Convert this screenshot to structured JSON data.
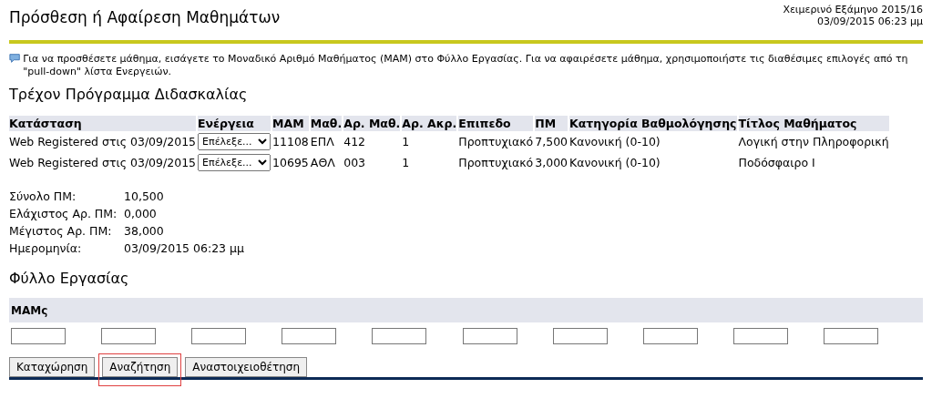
{
  "header": {
    "title": "Πρόσθεση ή Αφαίρεση Μαθημάτων",
    "term": "Χειμερινό Εξάμηνο 2015/16",
    "datetime": "03/09/2015 06:23 μμ"
  },
  "info": "Για να προσθέσετε μάθημα, εισάγετε το Μοναδικό Αριθμό Μαθήματος (ΜΑΜ) στο Φύλλο Εργασίας. Για να αφαιρέσετε μάθημα, χρησιμοποιήστε τις διαθέσιμες επιλογές από τη \"pull-down\" λίστα Ενεργειών.",
  "schedule": {
    "title": "Τρέχον Πρόγραμμα Διδασκαλίας",
    "columns": [
      "Κατάσταση",
      "Ενέργεια",
      "ΜΑΜ",
      "Μαθ.",
      "Αρ. Μαθ.",
      "Αρ. Ακρ.",
      "Επιπεδο",
      "ΠΜ",
      "Κατηγορία Βαθμολόγησης",
      "Τίτλος Μαθήματος"
    ],
    "rows": [
      {
        "status": "Web Registered στις 03/09/2015",
        "action": "Επέλεξε...",
        "mam": "11108",
        "subject": "ΕΠΛ",
        "course_no": "412",
        "credits_no": "1",
        "level": "Προπτυχιακό",
        "pm": "7,500",
        "grading": "Κανονική (0-10)",
        "title": "Λογική στην Πληροφορική"
      },
      {
        "status": "Web Registered στις 03/09/2015",
        "action": "Επέλεξε...",
        "mam": "10695",
        "subject": "ΑΘΛ",
        "course_no": "003",
        "credits_no": "1",
        "level": "Προπτυχιακό",
        "pm": "3,000",
        "grading": "Κανονική (0-10)",
        "title": "Ποδόσφαιρο Ι"
      }
    ]
  },
  "summary": [
    {
      "label": "Σύνολο ΠΜ:",
      "value": "10,500"
    },
    {
      "label": "Ελάχιστος Αρ. ΠΜ:",
      "value": "0,000"
    },
    {
      "label": "Μέγιστος Αρ. ΠΜ:",
      "value": "38,000"
    },
    {
      "label": "Ημερομηνία:",
      "value": "03/09/2015 06:23 μμ"
    }
  ],
  "worksheet": {
    "title": "Φύλλο Εργασίας",
    "column": "ΜΑΜς"
  },
  "buttons": [
    {
      "label": "Καταχώρηση",
      "highlighted": false
    },
    {
      "label": "Αναζήτηση",
      "highlighted": true
    },
    {
      "label": "Αναστοιχειοθέτηση",
      "highlighted": false
    }
  ]
}
